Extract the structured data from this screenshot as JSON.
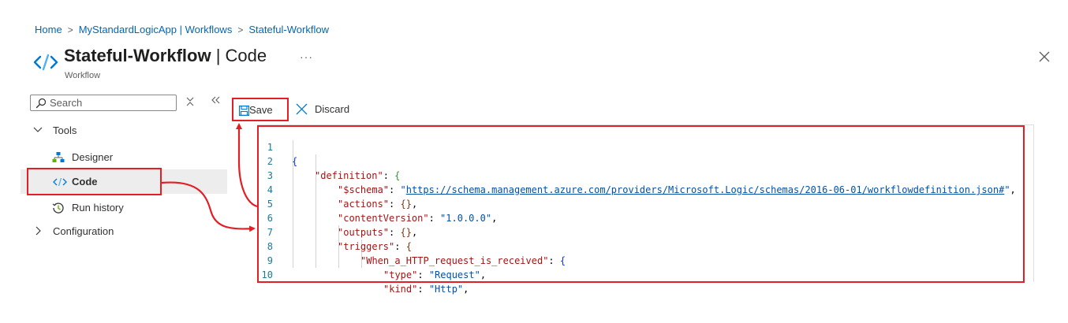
{
  "breadcrumb": {
    "home": "Home",
    "app": "MyStandardLogicApp | Workflows",
    "workflow": "Stateful-Workflow",
    "separator": ">"
  },
  "header": {
    "title": "Stateful-Workflow",
    "pipe": " | ",
    "mode": "Code",
    "subtitle": "Workflow",
    "more_label": "···"
  },
  "sidebar": {
    "search_placeholder": "Search",
    "groups": {
      "tools": "Tools",
      "configuration": "Configuration"
    },
    "items": {
      "designer": "Designer",
      "code": "Code",
      "run_history": "Run history"
    }
  },
  "toolbar": {
    "save_label": "Save",
    "discard_label": "Discard"
  },
  "editor": {
    "line_numbers": [
      "1",
      "2",
      "3",
      "4",
      "5",
      "6",
      "7",
      "8",
      "9",
      "10"
    ],
    "lines": {
      "l1": {
        "brace": "{"
      },
      "l2": {
        "key": "\"definition\"",
        "colon": ": ",
        "brace": "{"
      },
      "l3": {
        "key": "\"$schema\"",
        "colon": ": ",
        "q1": "\"",
        "url": "https://schema.management.azure.com/providers/Microsoft.Logic/schemas/2016-06-01/workflowdefinition.json#",
        "q2": "\"",
        "comma": ","
      },
      "l4": {
        "key": "\"actions\"",
        "colon": ": ",
        "val": "{}",
        "comma": ","
      },
      "l5": {
        "key": "\"contentVersion\"",
        "colon": ": ",
        "val": "\"1.0.0.0\"",
        "comma": ","
      },
      "l6": {
        "key": "\"outputs\"",
        "colon": ": ",
        "val": "{}",
        "comma": ","
      },
      "l7": {
        "key": "\"triggers\"",
        "colon": ": ",
        "brace": "{"
      },
      "l8": {
        "key": "\"When_a_HTTP_request_is_received\"",
        "colon": ": ",
        "brace": "{"
      },
      "l9": {
        "key": "\"type\"",
        "colon": ": ",
        "val": "\"Request\"",
        "comma": ","
      },
      "l10": {
        "key": "\"kind\"",
        "colon": ": ",
        "val": "\"Http\"",
        "comma": ","
      }
    }
  },
  "colors": {
    "accent": "#0067b8",
    "highlight_border": "#e31e24",
    "selected_bg": "#ededed"
  }
}
